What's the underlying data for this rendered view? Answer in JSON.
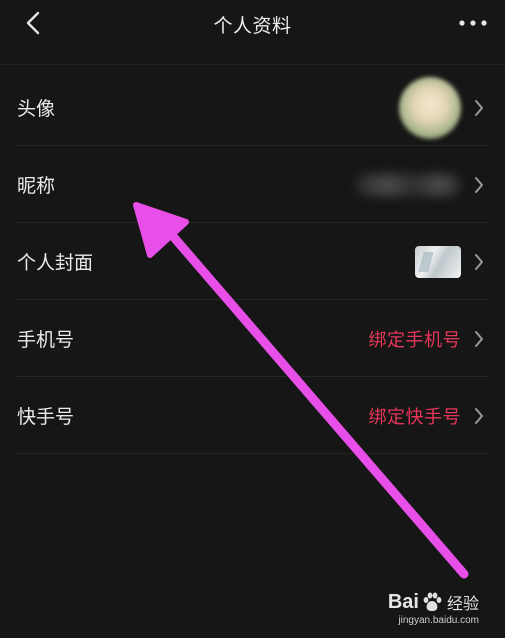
{
  "header": {
    "title": "个人资料",
    "back_icon": "back-chevron-icon",
    "more_icon": "more-dots-icon"
  },
  "rows": [
    {
      "label": "头像",
      "value_type": "avatar-image"
    },
    {
      "label": "昵称",
      "value_type": "blurred-text"
    },
    {
      "label": "个人封面",
      "value_type": "cover-image"
    },
    {
      "label": "手机号",
      "value": "绑定手机号"
    },
    {
      "label": "快手号",
      "value": "绑定快手号"
    }
  ],
  "colors": {
    "background": "#161616",
    "link_red": "#e8365a",
    "annotation_arrow": "#e84ee8"
  },
  "watermark": {
    "brand_left": "Bai",
    "brand_right": "经验",
    "url": "jingyan.baidu.com"
  }
}
